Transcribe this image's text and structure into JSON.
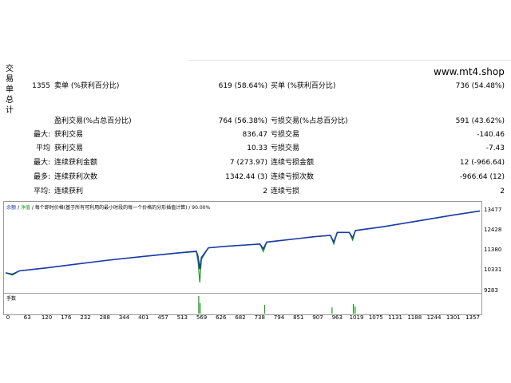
{
  "sidebar": {
    "title_chars": [
      "交",
      "易",
      "单",
      "总",
      "计"
    ]
  },
  "site": "www.mt4.shop",
  "stats": [
    {
      "c1": "1355",
      "c2": "卖单 (%获利百分比)",
      "c3": "619 (58.64%)",
      "c4": "买单 (%获利百分比)",
      "c5": "736 (54.48%)"
    },
    {
      "c1": "",
      "c2": "",
      "c3": "",
      "c4": "",
      "c5": ""
    },
    {
      "c1": "",
      "c2": "盈利交易(%占总百分比)",
      "c3": "764 (56.38%)",
      "c4": "亏损交易(%占总百分比)",
      "c5": "591 (43.62%)"
    },
    {
      "c1": "最大:",
      "c2": "获利交易",
      "c3": "836.47",
      "c4": "亏损交易",
      "c5": "-140.46"
    },
    {
      "c1": "平均",
      "c2": "获利交易",
      "c3": "10.33",
      "c4": "亏损交易",
      "c5": "-7.43"
    },
    {
      "c1": "最大:",
      "c2": "连续获利金额",
      "c3": "7 (273.97)",
      "c4": "连续亏损金额",
      "c5": "12 (-966.64)"
    },
    {
      "c1": "最多:",
      "c2": "连续获利次数",
      "c3": "1342.44 (3)",
      "c4": "连续亏损次数",
      "c5": "-966.64 (12)"
    },
    {
      "c1": "平均:",
      "c2": "连续获利",
      "c3": "2",
      "c4": "连续亏损",
      "c5": "2"
    }
  ],
  "chart": {
    "legend_balance": "余额",
    "legend_equity": "净值",
    "legend_rest": "每个即时价格(基于所有可利用的最小时段的每一个价格的分形插值计算)",
    "legend_quality": "90.00%",
    "volume_label": "手数",
    "colors": {
      "balance": "#1a3aa8",
      "equity": "#1b9a1b"
    }
  },
  "chart_data": {
    "type": "line",
    "ylim": [
      9283,
      13477
    ],
    "y_ticks": [
      "13477",
      "12428",
      "11380",
      "10331",
      "9283"
    ],
    "x_ticks": [
      "0",
      "63",
      "120",
      "176",
      "232",
      "288",
      "344",
      "401",
      "457",
      "513",
      "569",
      "626",
      "682",
      "738",
      "794",
      "851",
      "907",
      "963",
      "1019",
      "1075",
      "1131",
      "1188",
      "1244",
      "1301",
      "1357"
    ],
    "series": [
      {
        "points": [
          [
            0,
            10200
          ],
          [
            20,
            10130
          ],
          [
            40,
            10300
          ],
          [
            80,
            10380
          ],
          [
            120,
            10460
          ],
          [
            200,
            10640
          ],
          [
            300,
            10860
          ],
          [
            400,
            11050
          ],
          [
            500,
            11230
          ],
          [
            555,
            11320
          ],
          [
            560,
            11060
          ],
          [
            565,
            10400
          ],
          [
            570,
            11000
          ],
          [
            590,
            11500
          ],
          [
            640,
            11580
          ],
          [
            700,
            11650
          ],
          [
            740,
            11700
          ],
          [
            750,
            11450
          ],
          [
            760,
            11800
          ],
          [
            900,
            12080
          ],
          [
            945,
            12150
          ],
          [
            955,
            11800
          ],
          [
            965,
            12300
          ],
          [
            1000,
            12300
          ],
          [
            1010,
            12020
          ],
          [
            1018,
            12400
          ],
          [
            1100,
            12600
          ],
          [
            1200,
            12900
          ],
          [
            1300,
            13200
          ],
          [
            1380,
            13420
          ]
        ]
      },
      {
        "points": [
          [
            0,
            10200
          ],
          [
            20,
            10080
          ],
          [
            40,
            10300
          ],
          [
            80,
            10380
          ],
          [
            120,
            10460
          ],
          [
            200,
            10640
          ],
          [
            300,
            10860
          ],
          [
            400,
            11050
          ],
          [
            500,
            11230
          ],
          [
            555,
            11300
          ],
          [
            560,
            10800
          ],
          [
            565,
            9700
          ],
          [
            570,
            10900
          ],
          [
            590,
            11500
          ],
          [
            640,
            11580
          ],
          [
            700,
            11650
          ],
          [
            740,
            11700
          ],
          [
            750,
            11300
          ],
          [
            760,
            11800
          ],
          [
            900,
            12080
          ],
          [
            945,
            12150
          ],
          [
            955,
            11700
          ],
          [
            965,
            12300
          ],
          [
            1000,
            12300
          ],
          [
            1010,
            11900
          ],
          [
            1018,
            12400
          ],
          [
            1100,
            12600
          ],
          [
            1200,
            12900
          ],
          [
            1300,
            13200
          ],
          [
            1380,
            13420
          ]
        ]
      }
    ],
    "volume_spikes": [
      [
        562,
        1.0
      ],
      [
        566,
        0.6
      ],
      [
        754,
        0.5
      ],
      [
        950,
        0.35
      ],
      [
        1012,
        0.55
      ],
      [
        1017,
        0.4
      ]
    ]
  }
}
